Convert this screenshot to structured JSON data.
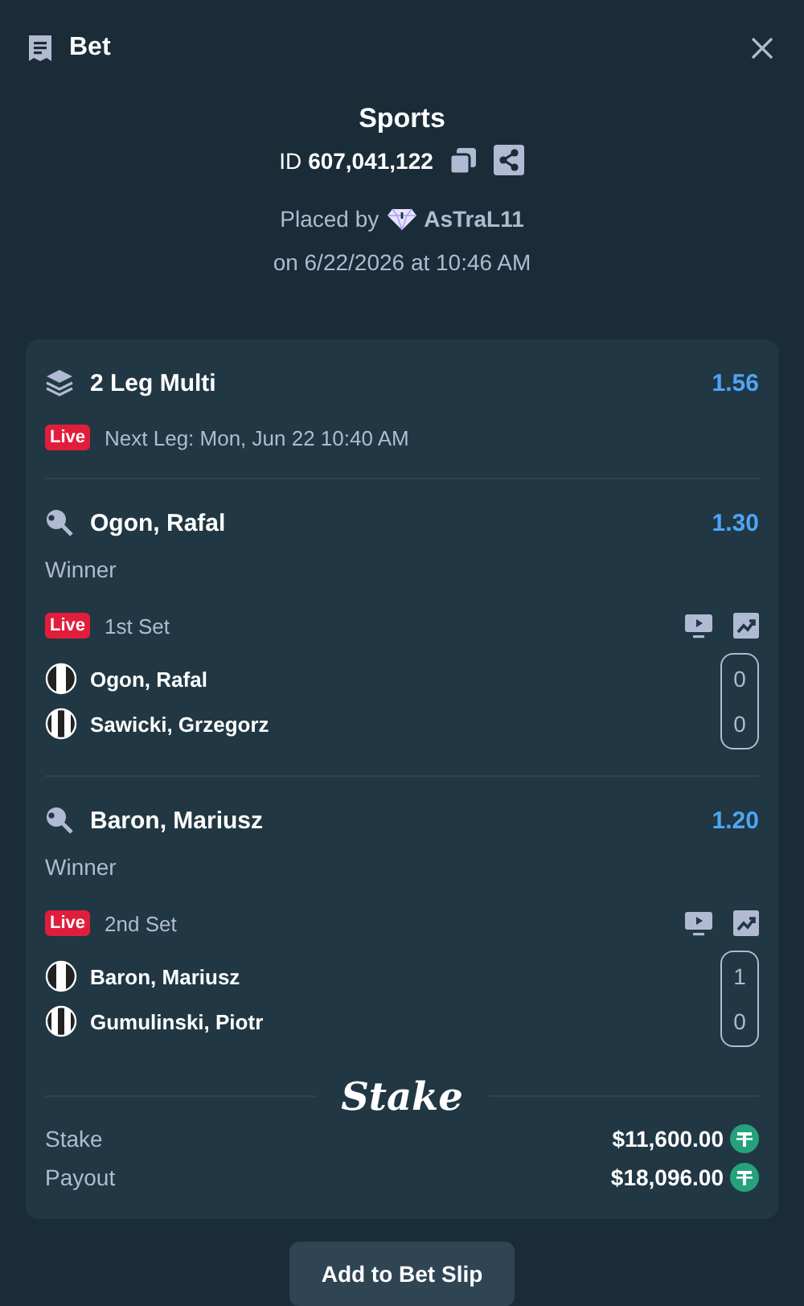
{
  "header": {
    "title": "Bet"
  },
  "summary": {
    "category": "Sports",
    "id_label": "ID",
    "id_value": "607,041,122",
    "placed_by_label": "Placed by",
    "user": "AsTraL11",
    "date": "on 6/22/2026 at 10:46 AM"
  },
  "multi": {
    "title": "2 Leg Multi",
    "odds": "1.56",
    "live_badge": "Live",
    "next_leg": "Next Leg: Mon, Jun 22 10:40 AM"
  },
  "legs": [
    {
      "selection": "Ogon, Rafal",
      "odds": "1.30",
      "market": "Winner",
      "live_badge": "Live",
      "period": "1st Set",
      "competitors": [
        {
          "name": "Ogon, Rafal",
          "score": "0"
        },
        {
          "name": "Sawicki, Grzegorz",
          "score": "0"
        }
      ]
    },
    {
      "selection": "Baron, Mariusz",
      "odds": "1.20",
      "market": "Winner",
      "live_badge": "Live",
      "period": "2nd Set",
      "competitors": [
        {
          "name": "Baron, Mariusz",
          "score": "1"
        },
        {
          "name": "Gumulinski, Piotr",
          "score": "0"
        }
      ]
    }
  ],
  "brand": "Stake",
  "totals": [
    {
      "label": "Stake",
      "amount": "$11,600.00"
    },
    {
      "label": "Payout",
      "amount": "$18,096.00"
    }
  ],
  "button": "Add to Bet Slip"
}
